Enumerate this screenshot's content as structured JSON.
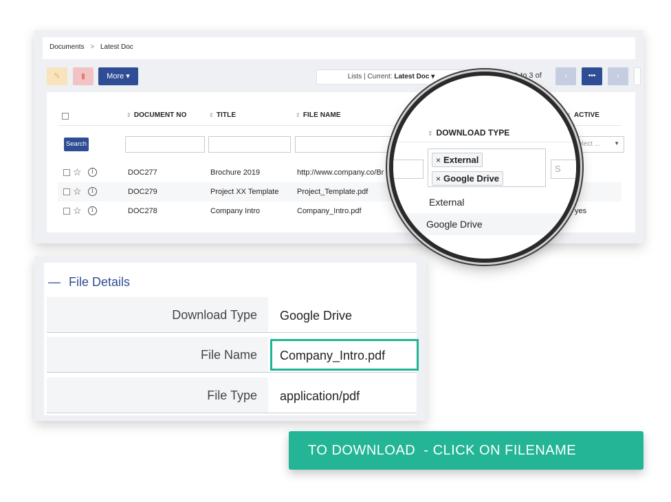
{
  "breadcrumb": {
    "root": "Documents",
    "separator": ">",
    "current": "Latest Doc"
  },
  "toolbar": {
    "edit_icon": "pencil-icon",
    "delete_icon": "trash-icon",
    "more_label": "More ▾"
  },
  "lists": {
    "prefix": "Lists | Current: ",
    "current": "Latest Doc ▾"
  },
  "pager": {
    "text": "1 to 3  of",
    "prev": "‹",
    "mid": "•••",
    "next": "›"
  },
  "table": {
    "headers": {
      "doc_no": "DOCUMENT NO",
      "title": "TITLE",
      "file_name": "FILE NAME",
      "active": "ACTIVE"
    },
    "sort_glyph": "⇕",
    "search_label": "Search",
    "active_placeholder": "elect ...",
    "rows": [
      {
        "doc_no": "DOC277",
        "title": "Brochure 2019",
        "file_name": "http://www.company.co/Br",
        "extra": "",
        "active": ""
      },
      {
        "doc_no": "DOC279",
        "title": "Project XX Template",
        "file_name": "Project_Template.pdf",
        "extra": "",
        "active": "s"
      },
      {
        "doc_no": "DOC278",
        "title": "Company Intro",
        "file_name": "Company_Intro.pdf",
        "extra": "al",
        "active": "yes"
      }
    ]
  },
  "magnifier": {
    "header": "DOWNLOAD TYPE",
    "selected_tags": [
      "External",
      "Google Drive"
    ],
    "right_input_text": "S",
    "rows": [
      "External",
      "Google Drive"
    ]
  },
  "file_details": {
    "title": "File Details",
    "collapse_glyph": "—",
    "rows": [
      {
        "label": "Download Type",
        "value": "Google Drive"
      },
      {
        "label": "File Name",
        "value": "Company_Intro.pdf"
      },
      {
        "label": "File Type",
        "value": "application/pdf"
      }
    ]
  },
  "cta": {
    "text": "TO DOWNLOAD  - CLICK ON FILENAME"
  },
  "colors": {
    "primary": "#2e4d94",
    "accent_teal": "#23b595",
    "highlight_border": "#1fb493"
  }
}
